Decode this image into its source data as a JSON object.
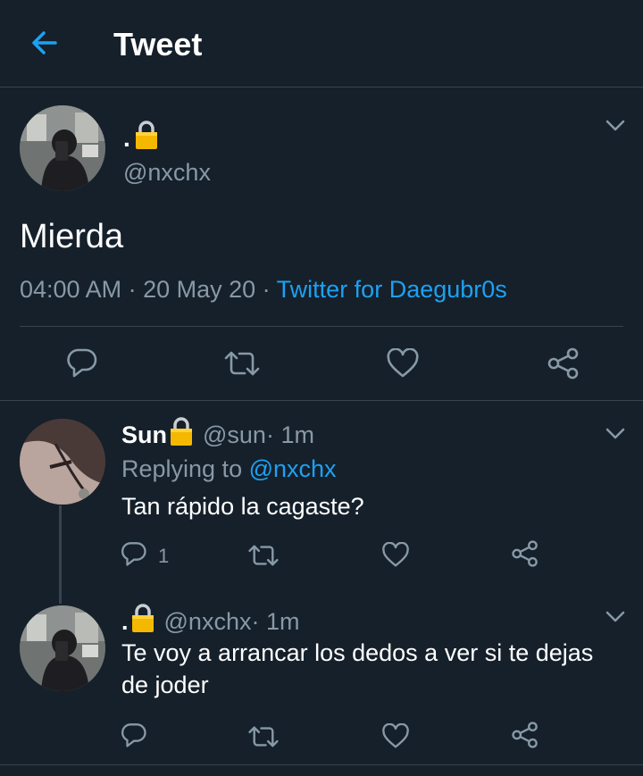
{
  "header": {
    "title": "Tweet"
  },
  "main_tweet": {
    "name": ".",
    "handle": "@nxchx",
    "text": "Mierda",
    "time": "04:00 AM",
    "dot1": " · ",
    "date": "20 May 20",
    "dot2": " · ",
    "source": "Twitter for Daegubr0s"
  },
  "replies": [
    {
      "name": "Sun",
      "handle": "@sun",
      "time": " · 1m",
      "replying_prefix": "Replying to ",
      "replying_to": "@nxchx",
      "text": "Tan rápido la cagaste?",
      "reply_count": "1"
    },
    {
      "name": ".",
      "handle": "@nxchx",
      "time": " · 1m",
      "text_line1": "Te voy a arrancar los dedos a ver si te dejas",
      "text_line2": "de joder"
    }
  ],
  "colors": {
    "background": "#15202b",
    "accent": "#1da1f2",
    "muted": "#8899a6",
    "divider": "#38444d",
    "lock": "#f5b800"
  },
  "icons": [
    "back-arrow-icon",
    "lock-icon",
    "chevron-down-icon",
    "reply-icon",
    "retweet-icon",
    "like-icon",
    "share-icon"
  ]
}
